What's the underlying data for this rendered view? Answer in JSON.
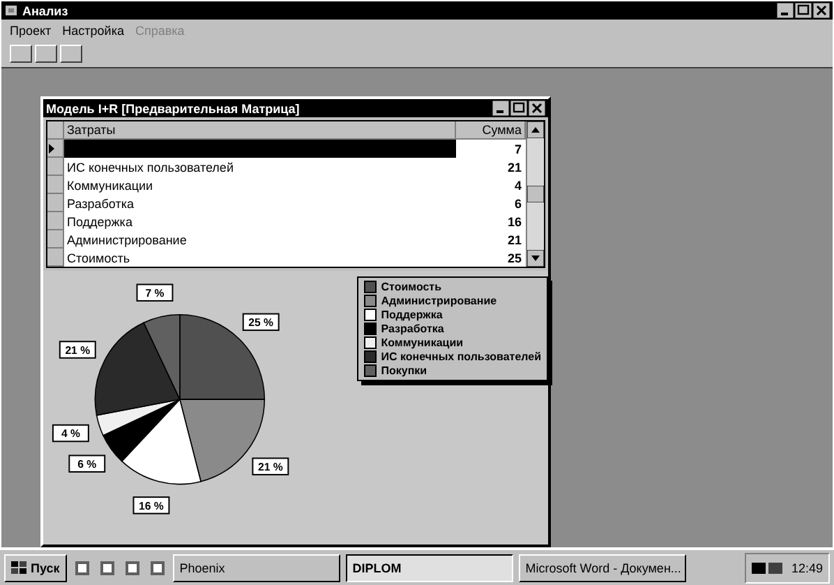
{
  "window": {
    "title": "Анализ"
  },
  "menu": [
    {
      "label": "Проект",
      "disabled": false
    },
    {
      "label": "Настройка",
      "disabled": false
    },
    {
      "label": "Справка",
      "disabled": true
    }
  ],
  "child_window": {
    "title": "Модель I+R [Предварительная Матрица]",
    "table": {
      "columns": [
        "Затраты",
        "Сумма"
      ],
      "rows": [
        {
          "selected": true,
          "sum": "7"
        },
        {
          "name": "ИС конечных пользователей",
          "selected": false,
          "sum": "21"
        },
        {
          "name": "Коммуникации",
          "selected": false,
          "sum": "4"
        },
        {
          "name": "Разработка",
          "selected": false,
          "sum": "6"
        },
        {
          "name": "Поддержка",
          "selected": false,
          "sum": "16"
        },
        {
          "name": "Администрирование",
          "selected": false,
          "sum": "21"
        },
        {
          "name": "Стоимость",
          "selected": false,
          "sum": "25"
        }
      ]
    },
    "legend": [
      {
        "color": "#505050"
      },
      {
        "color": "#8a8a8a"
      },
      {
        "color": "#ffffff"
      },
      {
        "color": "#000000"
      },
      {
        "color": "#f0f0f0"
      },
      {
        "color": "#2a2a2a"
      },
      {
        "color": "#606060"
      }
    ],
    "chart_data": {
      "type": "pie",
      "categories": [
        "Стоимость",
        "Администрирование",
        "Поддержка",
        "Разработка",
        "Коммуникации",
        "ИС конечных пользователей",
        "Покупки"
      ],
      "values": [
        25,
        21,
        16,
        6,
        4,
        21,
        7
      ],
      "value_labels": [
        "25 %",
        "21 %",
        "16 %",
        "6 %",
        "4 %",
        "21 %",
        "7 %"
      ]
    }
  },
  "taskbar": {
    "start": "Пуск",
    "tasks": [
      {
        "label": "Phoenix",
        "selected": false
      },
      {
        "label": "DIPLOM",
        "selected": true
      },
      {
        "label": "Microsoft Word - Докумен...",
        "selected": false
      }
    ],
    "clock": "12:49"
  }
}
